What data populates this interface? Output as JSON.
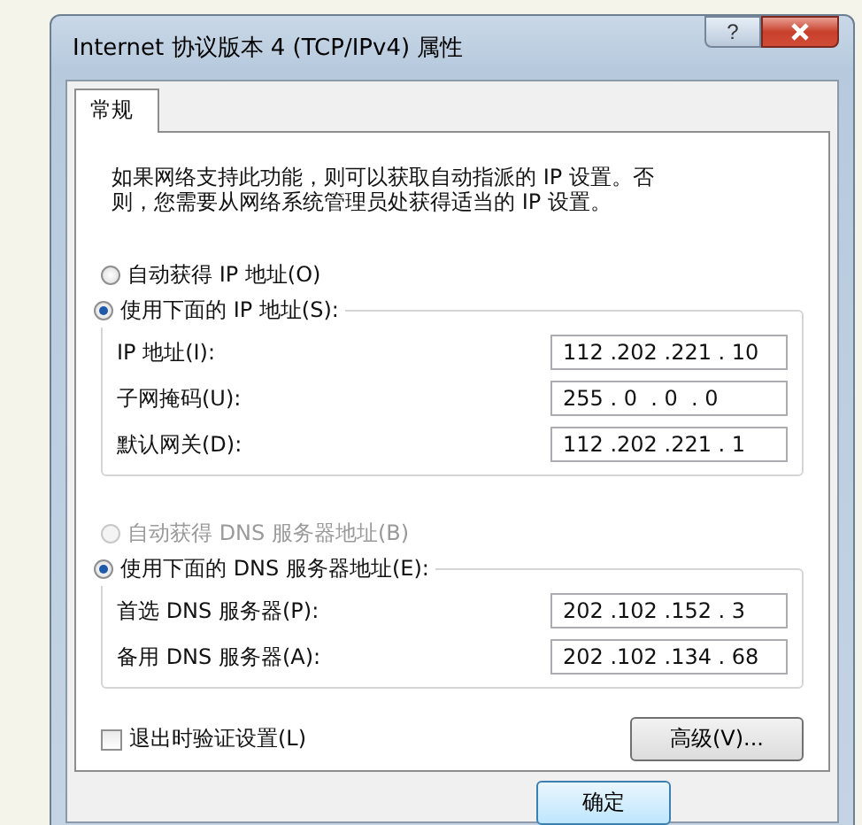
{
  "window": {
    "title": "Internet 协议版本 4 (TCP/IPv4) 属性",
    "help_label": "?"
  },
  "tabs": [
    {
      "label": "常规",
      "selected": true
    }
  ],
  "description": "如果网络支持此功能，则可以获取自动指派的 IP 设置。否则，您需要从网络系统管理员处获得适当的 IP 设置。",
  "ip_options": [
    {
      "label": "自动获得 IP 地址(O)",
      "selected": false,
      "disabled": false
    },
    {
      "label": "使用下面的 IP 地址(S):",
      "selected": true,
      "disabled": false
    }
  ],
  "ip_fields": [
    {
      "label": "IP 地址(I):",
      "value": "112 .202 .221 . 10"
    },
    {
      "label": "子网掩码(U):",
      "value": "255 . 0  . 0  . 0"
    },
    {
      "label": "默认网关(D):",
      "value": "112 .202 .221 . 1"
    }
  ],
  "dns_options": [
    {
      "label": "自动获得 DNS 服务器地址(B)",
      "selected": false,
      "disabled": true
    },
    {
      "label": "使用下面的 DNS 服务器地址(E):",
      "selected": true,
      "disabled": false
    }
  ],
  "dns_fields": [
    {
      "label": "首选 DNS 服务器(P):",
      "value": "202 .102 .152 . 3"
    },
    {
      "label": "备用 DNS 服务器(A):",
      "value": "202 .102 .134 . 68"
    }
  ],
  "validate_on_exit": {
    "label": "退出时验证设置(L)",
    "checked": false
  },
  "advanced_button": "高级(V)...",
  "ok_button": "确定"
}
